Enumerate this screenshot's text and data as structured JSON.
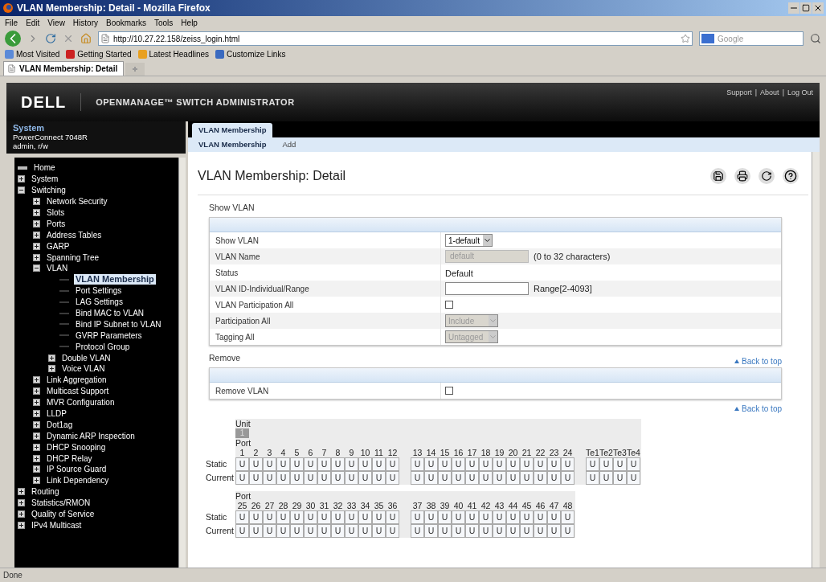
{
  "window": {
    "title": "VLAN Membership: Detail - Mozilla Firefox"
  },
  "menu": [
    "File",
    "Edit",
    "View",
    "History",
    "Bookmarks",
    "Tools",
    "Help"
  ],
  "navbar": {
    "url": "http://10.27.22.158/zeiss_login.html",
    "search_placeholder": "Google"
  },
  "bookmarks": [
    "Most Visited",
    "Getting Started",
    "Latest Headlines",
    "Customize Links"
  ],
  "browser_tabs": [
    {
      "label": "VLAN Membership: Detail",
      "selected": true
    }
  ],
  "header": {
    "brand": "DELL",
    "product": "OPENMANAGE™ SWITCH ADMINISTRATOR",
    "links": [
      "Support",
      "About",
      "Log Out"
    ],
    "separator": "|"
  },
  "system": {
    "title": "System",
    "model": "PowerConnect 7048R",
    "user": "admin, r/w"
  },
  "nav_tree": [
    {
      "label": "Home",
      "kind": "home",
      "selected": false
    },
    {
      "label": "System",
      "kind": "folder",
      "expanded": false,
      "selected": false
    },
    {
      "label": "Switching",
      "kind": "folder",
      "expanded": true,
      "selected": false,
      "children": [
        {
          "label": "Network Security",
          "kind": "folder",
          "expanded": false,
          "selected": false
        },
        {
          "label": "Slots",
          "kind": "folder",
          "expanded": false,
          "selected": false
        },
        {
          "label": "Ports",
          "kind": "folder",
          "expanded": false,
          "selected": false
        },
        {
          "label": "Address Tables",
          "kind": "folder",
          "expanded": false,
          "selected": false
        },
        {
          "label": "GARP",
          "kind": "folder",
          "expanded": false,
          "selected": false
        },
        {
          "label": "Spanning Tree",
          "kind": "folder",
          "expanded": false,
          "selected": false
        },
        {
          "label": "VLAN",
          "kind": "folder",
          "expanded": true,
          "selected": false,
          "children": [
            {
              "label": "VLAN Membership",
              "kind": "leaf",
              "selected": true
            },
            {
              "label": "Port Settings",
              "kind": "leaf",
              "selected": false
            },
            {
              "label": "LAG Settings",
              "kind": "leaf",
              "selected": false
            },
            {
              "label": "Bind MAC to VLAN",
              "kind": "leaf",
              "selected": false
            },
            {
              "label": "Bind IP Subnet to VLAN",
              "kind": "leaf",
              "selected": false
            },
            {
              "label": "GVRP Parameters",
              "kind": "leaf",
              "selected": false
            },
            {
              "label": "Protocol Group",
              "kind": "leaf",
              "selected": false
            },
            {
              "label": "Double VLAN",
              "kind": "folder",
              "expanded": false,
              "selected": false
            },
            {
              "label": "Voice VLAN",
              "kind": "folder",
              "expanded": false,
              "selected": false
            }
          ]
        },
        {
          "label": "Link Aggregation",
          "kind": "folder",
          "expanded": false,
          "selected": false
        },
        {
          "label": "Multicast Support",
          "kind": "folder",
          "expanded": false,
          "selected": false
        },
        {
          "label": "MVR Configuration",
          "kind": "folder",
          "expanded": false,
          "selected": false
        },
        {
          "label": "LLDP",
          "kind": "folder",
          "expanded": false,
          "selected": false
        },
        {
          "label": "Dot1ag",
          "kind": "folder",
          "expanded": false,
          "selected": false
        },
        {
          "label": "Dynamic ARP Inspection",
          "kind": "folder",
          "expanded": false,
          "selected": false
        },
        {
          "label": "DHCP Snooping",
          "kind": "folder",
          "expanded": false,
          "selected": false
        },
        {
          "label": "DHCP Relay",
          "kind": "folder",
          "expanded": false,
          "selected": false
        },
        {
          "label": "IP Source Guard",
          "kind": "folder",
          "expanded": false,
          "selected": false
        },
        {
          "label": "Link Dependency",
          "kind": "folder",
          "expanded": false,
          "selected": false
        }
      ]
    },
    {
      "label": "Routing",
      "kind": "folder",
      "expanded": false,
      "selected": false
    },
    {
      "label": "Statistics/RMON",
      "kind": "folder",
      "expanded": false,
      "selected": false
    },
    {
      "label": "Quality of Service",
      "kind": "folder",
      "expanded": false,
      "selected": false
    },
    {
      "label": "IPv4 Multicast",
      "kind": "folder",
      "expanded": false,
      "selected": false
    }
  ],
  "page_tabs": [
    {
      "label": "VLAN Membership",
      "selected": true
    }
  ],
  "sub_tabs": [
    {
      "label": "VLAN Membership",
      "selected": true
    },
    {
      "label": "Add",
      "selected": false
    }
  ],
  "page_title": "VLAN Membership: Detail",
  "sections": [
    {
      "title": "Show VLAN",
      "back_to_top": "Back to top",
      "rows": [
        {
          "label": "Show VLAN",
          "kind": "select",
          "value": "1-default",
          "disabled": false
        },
        {
          "label": "VLAN Name",
          "kind": "input",
          "value": "default",
          "disabled": true,
          "hint": "(0 to 32 characters)"
        },
        {
          "label": "Status",
          "kind": "text",
          "value": "Default"
        },
        {
          "label": "VLAN ID-Individual/Range",
          "kind": "input",
          "disabled": false,
          "hint": "Range[2-4093]"
        },
        {
          "label": "VLAN Participation All",
          "kind": "checkbox",
          "checked": false
        },
        {
          "label": "Participation All",
          "kind": "select",
          "value": "Include",
          "disabled": true
        },
        {
          "label": "Tagging All",
          "kind": "select",
          "value": "Untagged",
          "disabled": true
        }
      ]
    },
    {
      "title": "Remove",
      "back_to_top": "Back to top",
      "rows": [
        {
          "label": "Remove VLAN",
          "kind": "checkbox",
          "checked": false
        }
      ]
    }
  ],
  "ports": {
    "unit_label": "Unit",
    "units": [
      {
        "label": "1",
        "selected": true
      }
    ],
    "groups": [
      {
        "port_label": "Port",
        "row_labels": [
          "Static",
          "Current"
        ],
        "blocks": [
          {
            "ports": [
              "1",
              "2",
              "3",
              "4",
              "5",
              "6",
              "7",
              "8",
              "9",
              "10",
              "11",
              "12"
            ],
            "static": [
              "U",
              "U",
              "U",
              "U",
              "U",
              "U",
              "U",
              "U",
              "U",
              "U",
              "U",
              "U"
            ],
            "current": [
              "U",
              "U",
              "U",
              "U",
              "U",
              "U",
              "U",
              "U",
              "U",
              "U",
              "U",
              "U"
            ]
          },
          {
            "ports": [
              "13",
              "14",
              "15",
              "16",
              "17",
              "18",
              "19",
              "20",
              "21",
              "22",
              "23",
              "24"
            ],
            "static": [
              "U",
              "U",
              "U",
              "U",
              "U",
              "U",
              "U",
              "U",
              "U",
              "U",
              "U",
              "U"
            ],
            "current": [
              "U",
              "U",
              "U",
              "U",
              "U",
              "U",
              "U",
              "U",
              "U",
              "U",
              "U",
              "U"
            ]
          },
          {
            "ports": [
              "Te1",
              "Te2",
              "Te3",
              "Te4"
            ],
            "static": [
              "U",
              "U",
              "U",
              "U"
            ],
            "current": [
              "U",
              "U",
              "U",
              "U"
            ]
          }
        ]
      },
      {
        "port_label": "Port",
        "row_labels": [
          "Static",
          "Current"
        ],
        "blocks": [
          {
            "ports": [
              "25",
              "26",
              "27",
              "28",
              "29",
              "30",
              "31",
              "32",
              "33",
              "34",
              "35",
              "36"
            ],
            "static": [
              "U",
              "U",
              "U",
              "U",
              "U",
              "U",
              "U",
              "U",
              "U",
              "U",
              "U",
              "U"
            ],
            "current": [
              "U",
              "U",
              "U",
              "U",
              "U",
              "U",
              "U",
              "U",
              "U",
              "U",
              "U",
              "U"
            ]
          },
          {
            "ports": [
              "37",
              "38",
              "39",
              "40",
              "41",
              "42",
              "43",
              "44",
              "45",
              "46",
              "47",
              "48"
            ],
            "static": [
              "U",
              "U",
              "U",
              "U",
              "U",
              "U",
              "U",
              "U",
              "U",
              "U",
              "U",
              "U"
            ],
            "current": [
              "U",
              "U",
              "U",
              "U",
              "U",
              "U",
              "U",
              "U",
              "U",
              "U",
              "U",
              "U"
            ]
          }
        ]
      }
    ]
  },
  "status_bar": "Done"
}
